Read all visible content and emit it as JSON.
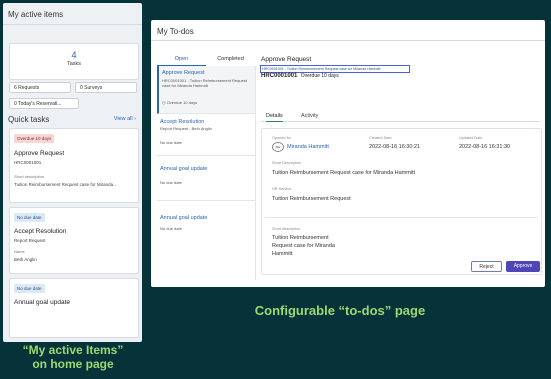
{
  "left_panel": {
    "title": "My active items",
    "tasks": {
      "count": "4",
      "label": "Tasks"
    },
    "counters": [
      "6 Requests",
      "0 Surveys",
      "0 Today's Reservati..."
    ],
    "quick_tasks": {
      "title": "Quick tasks",
      "view_all": "View all"
    },
    "cards": [
      {
        "badge": "Overdue 10 days",
        "title": "Approve Request",
        "number": "HRC0001001",
        "short_label": "Short description",
        "short_value": "Tuition Reimbursement Request case for Miranda..."
      },
      {
        "badge": "No due date",
        "title": "Accept Resolution",
        "subtitle": "Report Request",
        "name_label": "Name",
        "name_value": "Beth Anglin"
      },
      {
        "badge": "No due date",
        "title": "Annual goal update"
      }
    ]
  },
  "right_panel": {
    "title": "My To-dos",
    "tabs": [
      "Open",
      "Completed"
    ],
    "list": [
      {
        "title": "Approve Request",
        "sub": "HRC0001001 - Tuition Reimbursement Request case for Miranda Hammitt",
        "due": "Overdue 10 days"
      },
      {
        "title": "Accept Resolution",
        "sub": "Report Request - Beth Anglin",
        "due": "No due date"
      },
      {
        "title": "Annual goal update",
        "due": "No due date"
      },
      {
        "title": "Annual goal update",
        "due": "No due date"
      }
    ],
    "detail": {
      "header": "Approve Request",
      "link": "HRC0001001 - Tuition Reimbursement Request case for Miranda Hammitt",
      "number": "HRC0001001",
      "overdue": "Overdue 10 days",
      "tabs": [
        "Details",
        "Activity"
      ],
      "opened_for_label": "Opened for",
      "opened_for_initials": "MH",
      "opened_for": "Miranda Hammitt",
      "created_label": "Created Date",
      "created": "2022-08-16 16:30:21",
      "updated_label": "Updated Date",
      "updated": "2022-08-16 16:31:30",
      "short_label": "Short Description",
      "short": "Tuition Reimbursement Request case for Miranda Hammitt",
      "service_label": "HR Service",
      "service": "Tuition Reimbursement Request",
      "short2_label": "Short description",
      "short2_line1": "Tuition Reimbursement",
      "short2_line2": "Request case for Miranda",
      "short2_line3": "Hammitt",
      "reject": "Reject",
      "approve": "Approve"
    }
  },
  "captions": {
    "right": "Configurable “to-dos” page",
    "left_line1": "“My active Items”",
    "left_line2": "on home page"
  },
  "colors": {
    "background": "#06323a",
    "caption": "#9fd870",
    "accent": "#2a62b8",
    "approve": "#4f46b5"
  }
}
